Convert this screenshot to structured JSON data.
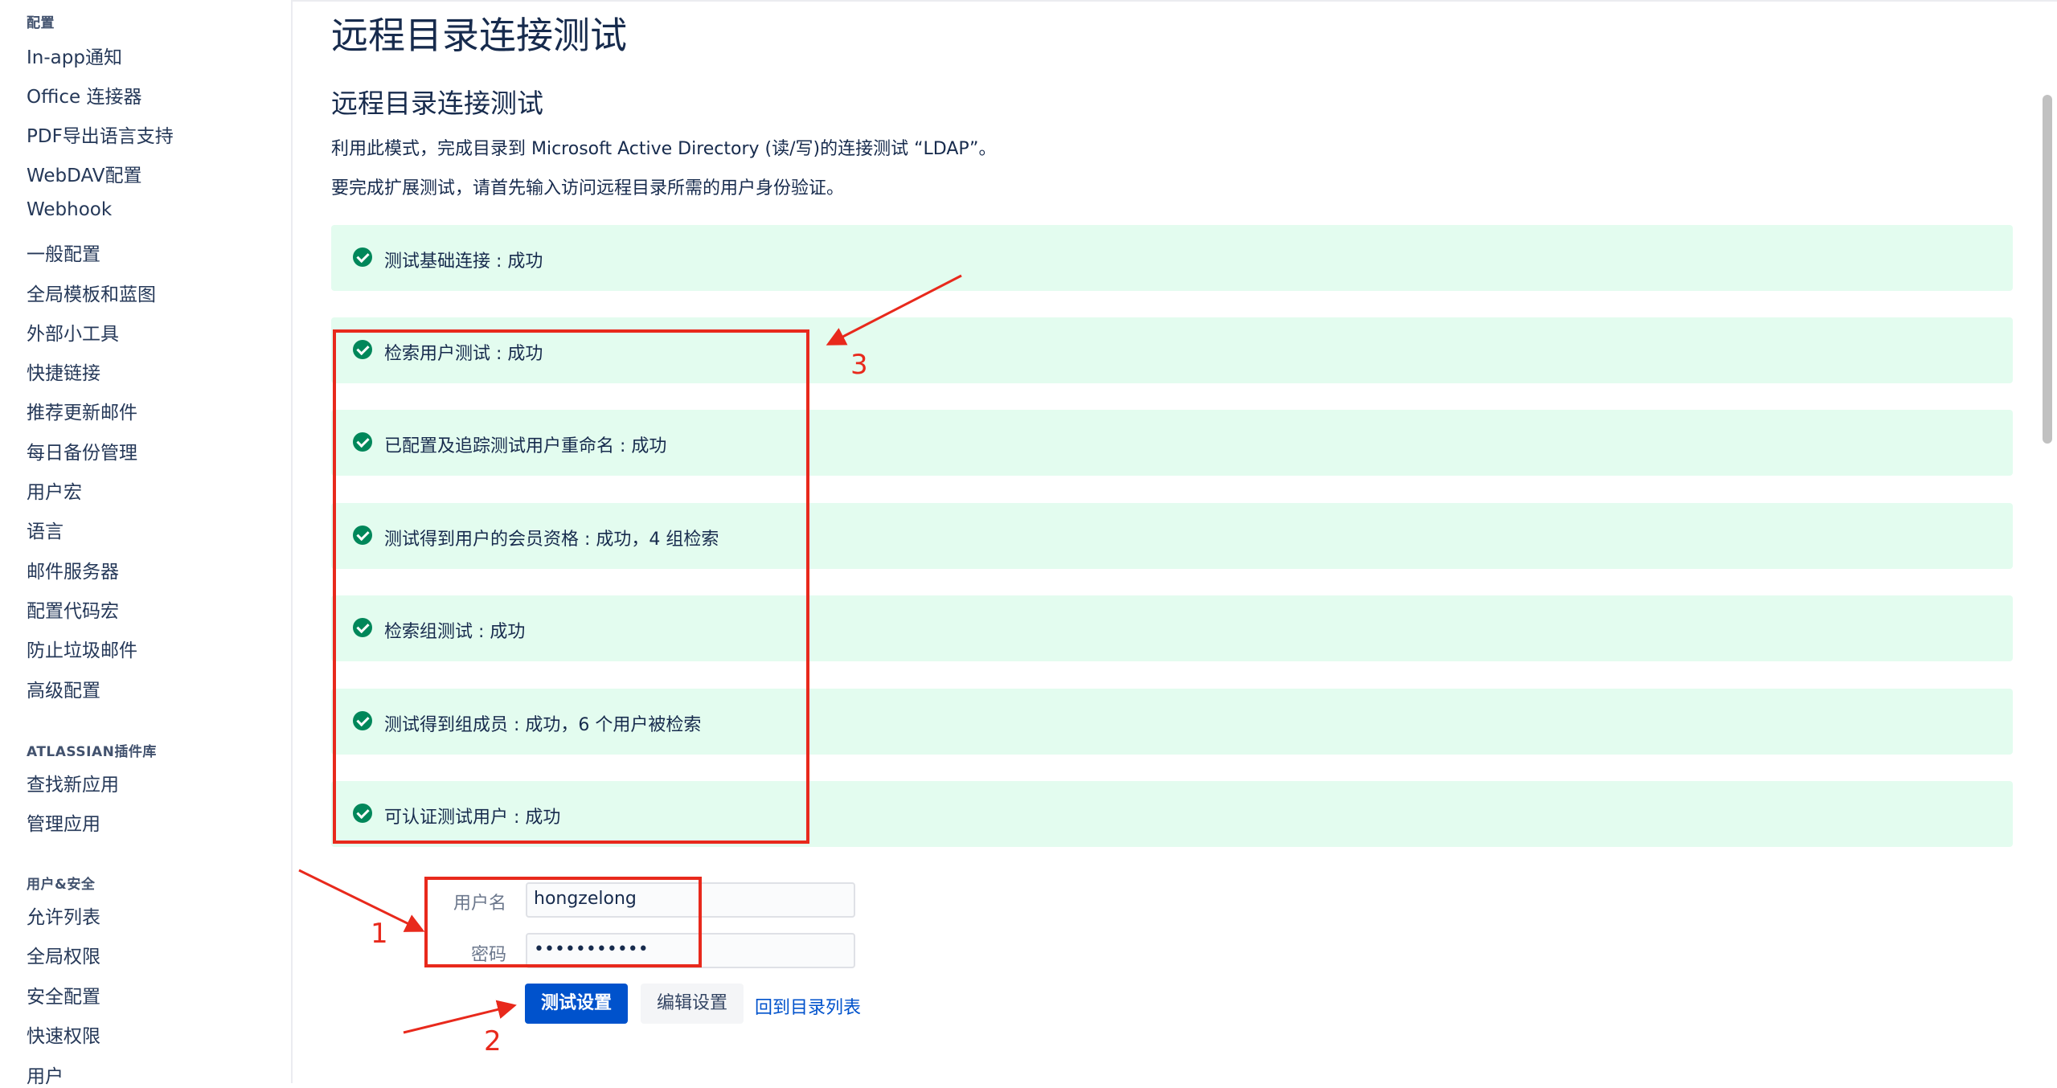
{
  "sidebar": {
    "sections": [
      {
        "head": "配置",
        "items": [
          "In-app通知",
          "Office 连接器",
          "PDF导出语言支持",
          "WebDAV配置",
          "Webhook",
          "一般配置",
          "全局模板和蓝图",
          "外部小工具",
          "快捷链接",
          "推荐更新邮件",
          "每日备份管理",
          "用户宏",
          "语言",
          "邮件服务器",
          "配置代码宏",
          "防止垃圾邮件",
          "高级配置"
        ]
      },
      {
        "head": "ATLASSIAN插件库",
        "items": [
          "查找新应用",
          "管理应用"
        ]
      },
      {
        "head": "用户&安全",
        "items": [
          "允许列表",
          "全局权限",
          "安全配置",
          "快速权限",
          "用户"
        ]
      }
    ]
  },
  "main": {
    "page_title": "远程目录连接测试",
    "sub_title": "远程目录连接测试",
    "desc1": "利用此模式，完成目录到 Microsoft Active Directory (读/写)的连接测试 “LDAP”。",
    "desc2": "要完成扩展测试，请首先输入访问远程目录所需的用户身份验证。",
    "results": [
      "测试基础连接 : 成功",
      "检索用户测试 : 成功",
      "已配置及追踪测试用户重命名 : 成功",
      "测试得到用户的会员资格 : 成功，4 组检索",
      "检索组测试 : 成功",
      "测试得到组成员 : 成功，6 个用户被检索",
      "可认证测试用户 : 成功"
    ],
    "form": {
      "username_label": "用户名",
      "username_value": "hongzelong",
      "password_label": "密码",
      "password_value": "•••••••••••"
    },
    "buttons": {
      "test": "测试设置",
      "edit": "编辑设置",
      "back": "回到目录列表"
    }
  },
  "annotations": {
    "one": "1",
    "two": "2",
    "three": "3",
    "color": "#e8291c"
  }
}
